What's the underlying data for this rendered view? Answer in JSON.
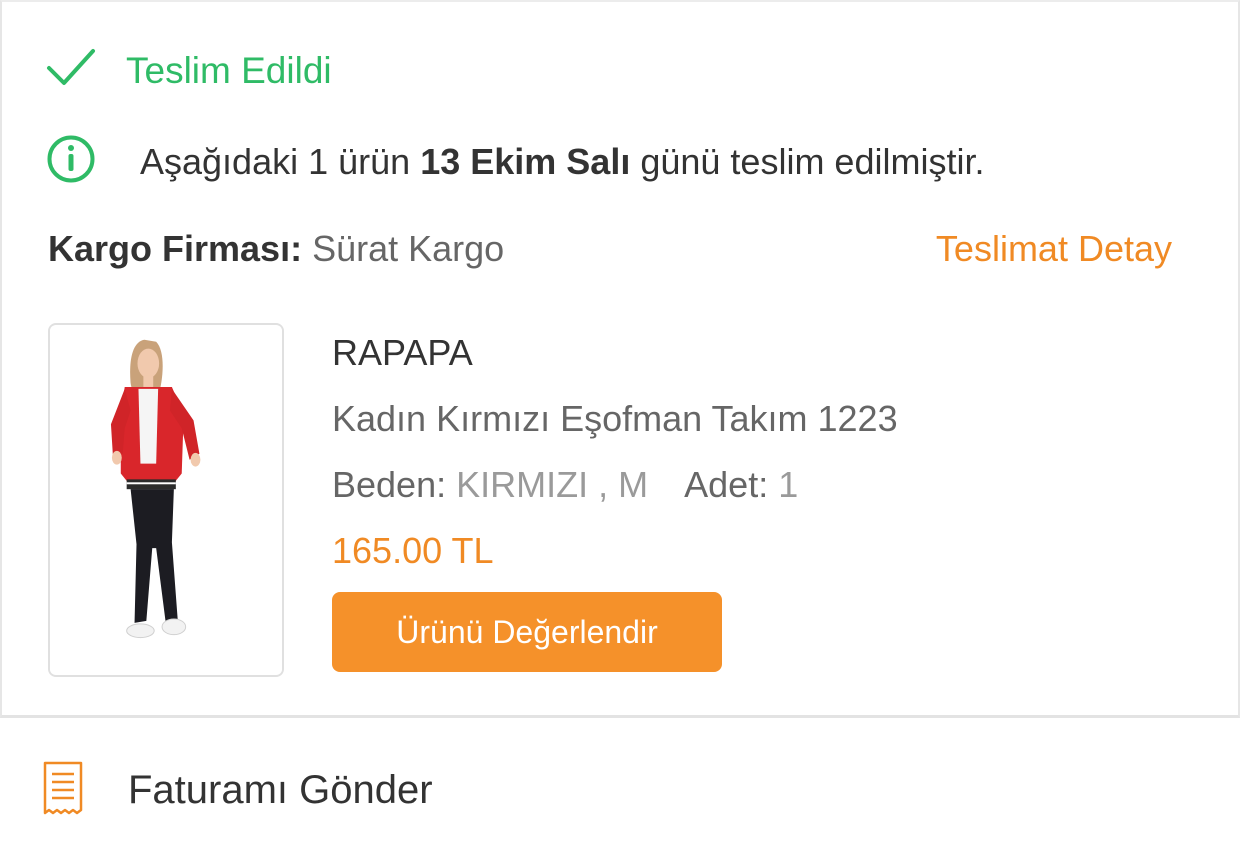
{
  "status": {
    "icon": "check-icon",
    "label": "Teslim Edildi",
    "color": "#2fbb66"
  },
  "info": {
    "icon": "info-icon",
    "text_before": "Aşağıdaki 1 ürün ",
    "text_bold": "13 Ekim Salı",
    "text_after": " günü teslim edilmiştir."
  },
  "cargo": {
    "label": "Kargo Firması:",
    "value": "Sürat Kargo",
    "detail_link": "Teslimat Detay"
  },
  "product": {
    "image_icon": "product-photo",
    "brand": "RAPAPA",
    "name": "Kadın Kırmızı Eşofman Takım 1223",
    "size_label": "Beden:",
    "size_value": "KIRMIZI , M",
    "quantity_label": "Adet:",
    "quantity_value": "1",
    "price": "165.00 TL",
    "rate_button": "Ürünü Değerlendir"
  },
  "invoice": {
    "icon": "receipt-icon",
    "label": "Faturamı Gönder"
  },
  "colors": {
    "accent": "#f5912a",
    "success": "#2fbb66"
  }
}
